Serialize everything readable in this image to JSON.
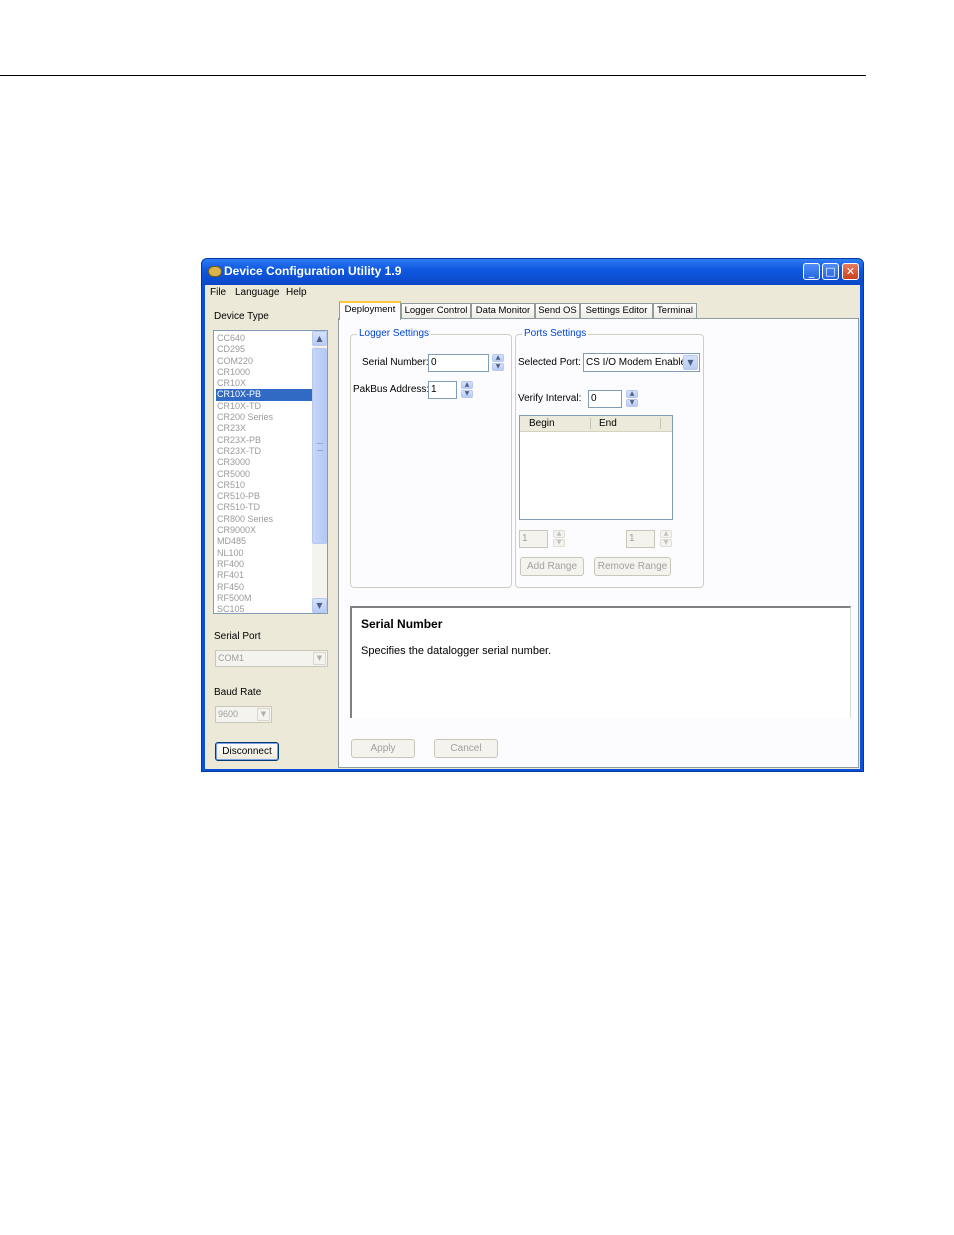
{
  "window": {
    "title": "Device Configuration Utility 1.9"
  },
  "menu": {
    "items": [
      "File",
      "Language",
      "Help"
    ]
  },
  "left": {
    "device_type_label": "Device Type",
    "devices": [
      "CC640",
      "CD295",
      "COM220",
      "CR1000",
      "CR10X",
      "CR10X-PB",
      "CR10X-TD",
      "CR200 Series",
      "CR23X",
      "CR23X-PB",
      "CR23X-TD",
      "CR3000",
      "CR5000",
      "CR510",
      "CR510-PB",
      "CR510-TD",
      "CR800 Series",
      "CR9000X",
      "MD485",
      "NL100",
      "RF400",
      "RF401",
      "RF450",
      "RF500M",
      "SC105"
    ],
    "selected_device": "CR10X-PB",
    "serial_port_label": "Serial Port",
    "serial_port_value": "COM1",
    "baud_rate_label": "Baud Rate",
    "baud_rate_value": "9600",
    "disconnect_label": "Disconnect"
  },
  "tabs": [
    "Deployment",
    "Logger Control",
    "Data Monitor",
    "Send OS",
    "Settings Editor",
    "Terminal"
  ],
  "active_tab": "Deployment",
  "logger_settings": {
    "title": "Logger Settings",
    "serial_number_label": "Serial Number:",
    "serial_number_value": "0",
    "pakbus_label": "PakBus Address:",
    "pakbus_value": "1"
  },
  "ports_settings": {
    "title": "Ports Settings",
    "selected_port_label": "Selected Port:",
    "selected_port_value": "CS I/O Modem Enable",
    "verify_interval_label": "Verify Interval:",
    "verify_interval_value": "0",
    "columns": [
      "Begin",
      "End"
    ],
    "range_begin_value": "1",
    "range_end_value": "1",
    "add_range_label": "Add Range",
    "remove_range_label": "Remove Range"
  },
  "help": {
    "title": "Serial Number",
    "body": "Specifies the datalogger serial number."
  },
  "buttons": {
    "apply": "Apply",
    "cancel": "Cancel"
  }
}
